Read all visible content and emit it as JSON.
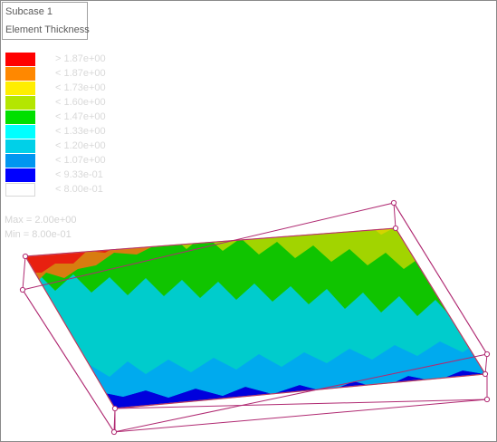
{
  "title": {
    "subcase": "Subcase 1",
    "result": "Element Thickness"
  },
  "legend": {
    "entries": [
      {
        "label": "> 1.87e+00",
        "color": "#ff0000"
      },
      {
        "label": "< 1.87e+00",
        "color": "#ff8800"
      },
      {
        "label": "< 1.73e+00",
        "color": "#ffee00"
      },
      {
        "label": "< 1.60e+00",
        "color": "#b4e600"
      },
      {
        "label": "< 1.47e+00",
        "color": "#00e000"
      },
      {
        "label": "< 1.33e+00",
        "color": "#00ffff"
      },
      {
        "label": "< 1.20e+00",
        "color": "#00d0e8"
      },
      {
        "label": "< 1.07e+00",
        "color": "#0096f0"
      },
      {
        "label": "< 9.33e-01",
        "color": "#0000ff"
      },
      {
        "label": "< 8.00e-01",
        "color": "#ffffff"
      }
    ],
    "max": "Max = 2.00e+00",
    "min": "Min = 8.00e-01"
  },
  "colors": {
    "wireframe": "#b02a72",
    "plate_edge": "#e8a030",
    "band_red": "#e82010",
    "band_orange": "#d87c10",
    "band_yellow": "#d4d400",
    "band_yellowgreen": "#a2d400",
    "band_green": "#10c400",
    "band_cyan": "#00cccc",
    "band_lightblue": "#00aaee",
    "band_blue": "#0000dd"
  }
}
